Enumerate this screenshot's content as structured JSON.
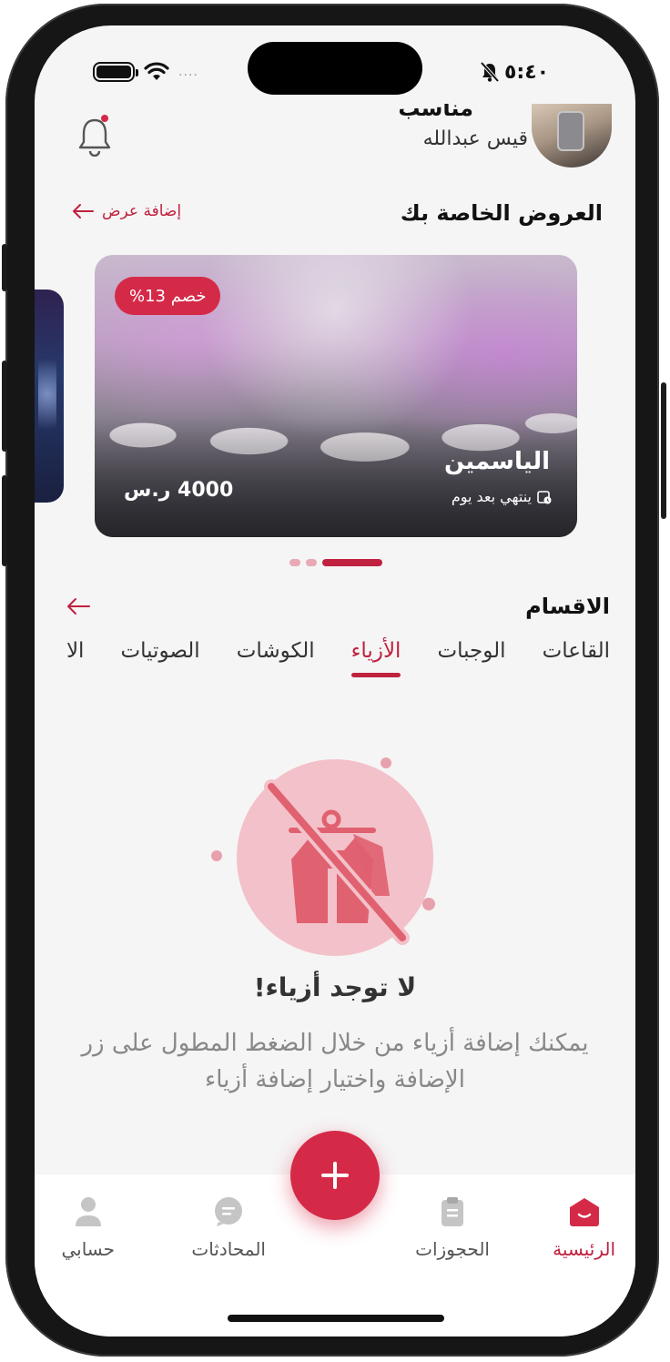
{
  "status_bar": {
    "time": "٥:٤٠",
    "signal_dots": "...."
  },
  "profile": {
    "role": "مناسب",
    "name": "قيس عبدالله"
  },
  "offers": {
    "title": "العروض الخاصة بك",
    "add_label": "إضافة عرض",
    "card": {
      "discount": "خصم 13%",
      "venue_name": "الياسمين",
      "ends_text": "ينتهي بعد يوم",
      "price": "4000 ر.س"
    }
  },
  "carousel": {
    "count": 3,
    "active_index": 0
  },
  "categories": {
    "title": "الاقسام",
    "tabs": [
      {
        "label": "القاعات",
        "active": false
      },
      {
        "label": "الوجبات",
        "active": false
      },
      {
        "label": "الأزياء",
        "active": true
      },
      {
        "label": "الكوشات",
        "active": false
      },
      {
        "label": "الصوتيات",
        "active": false
      },
      {
        "label": "الا",
        "active": false
      }
    ]
  },
  "empty_state": {
    "icon": "no-clothes-icon",
    "title": "لا توجد أزياء!",
    "description": "يمكنك إضافة أزياء من خلال الضغط المطول على زر الإضافة واختيار إضافة أزياء"
  },
  "fab": {
    "icon": "plus-icon"
  },
  "bottom_nav": {
    "items": [
      {
        "label": "الرئيسية",
        "icon": "home-icon",
        "active": true
      },
      {
        "label": "الحجوزات",
        "icon": "clipboard-icon",
        "active": false
      },
      {
        "label": "المحادثات",
        "icon": "chat-icon",
        "active": false
      },
      {
        "label": "حسابي",
        "icon": "user-icon",
        "active": false
      }
    ]
  },
  "colors": {
    "accent": "#c0213f",
    "accent_light": "#f3c1c9",
    "background": "#f5f5f5"
  }
}
